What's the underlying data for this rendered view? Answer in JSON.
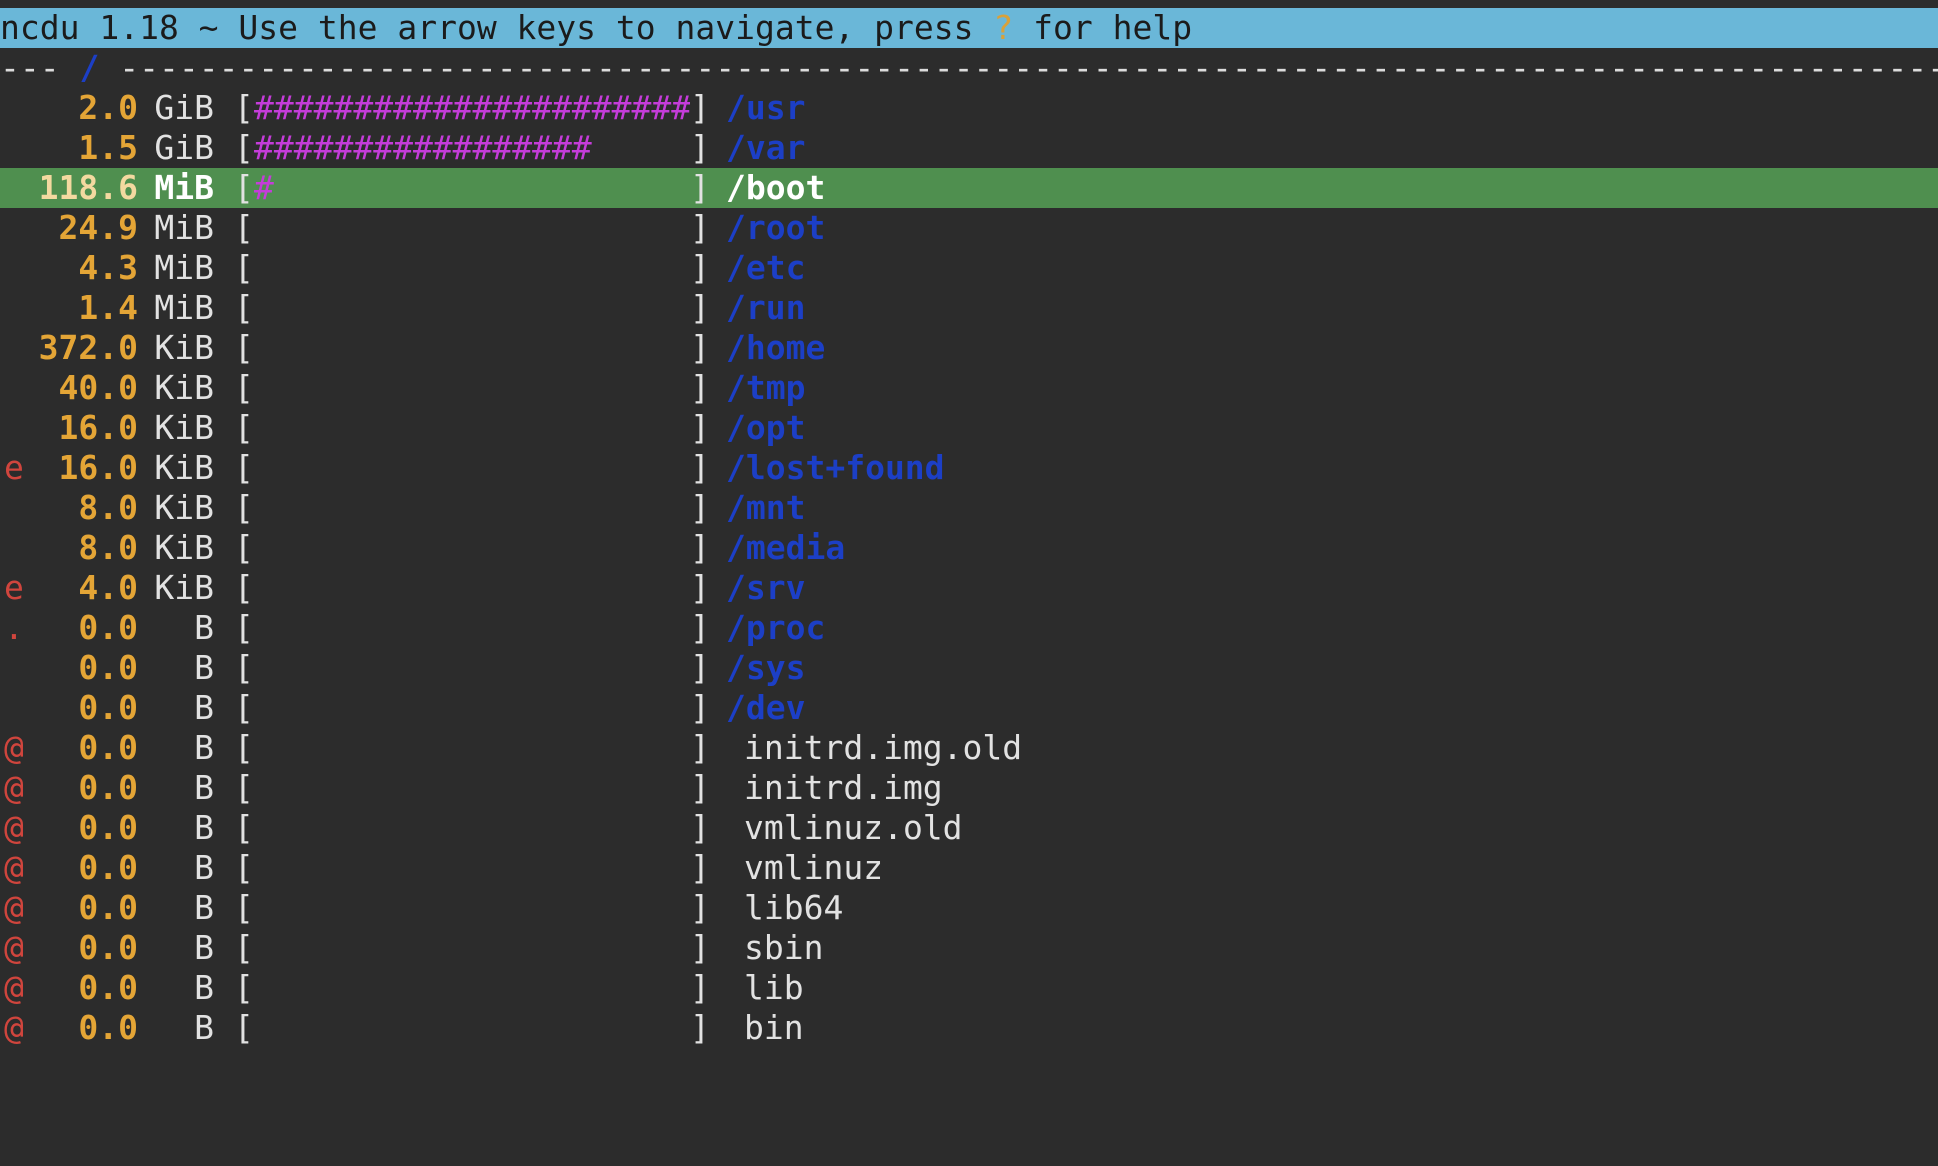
{
  "app": {
    "title_text": "ncdu 1.18 ~ Use the arrow keys to navigate, press ",
    "help_key": "?",
    "title_tail": " for help"
  },
  "path_bar": {
    "left_dashes": "--- ",
    "path": "/",
    "right_dashes": " ----------------------------------------------------------------------------------------------------------------------------------------"
  },
  "colors": {
    "header_bg": "#6ab7d8",
    "selected_bg": "#4f8f4f",
    "size_color": "#e4a536",
    "bar_color": "#c43cd9",
    "dir_color": "#1c3fc6",
    "flag_color": "#d0453d"
  },
  "selected_index": 2,
  "entries": [
    {
      "flag": "",
      "size": "2.0",
      "unit": "GiB",
      "bar": "#######################",
      "name": "/usr",
      "dir": true
    },
    {
      "flag": "",
      "size": "1.5",
      "unit": "GiB",
      "bar": "#################",
      "name": "/var",
      "dir": true
    },
    {
      "flag": "",
      "size": "118.6",
      "unit": "MiB",
      "bar": "#",
      "name": "/boot",
      "dir": true
    },
    {
      "flag": "",
      "size": "24.9",
      "unit": "MiB",
      "bar": "",
      "name": "/root",
      "dir": true
    },
    {
      "flag": "",
      "size": "4.3",
      "unit": "MiB",
      "bar": "",
      "name": "/etc",
      "dir": true
    },
    {
      "flag": "",
      "size": "1.4",
      "unit": "MiB",
      "bar": "",
      "name": "/run",
      "dir": true
    },
    {
      "flag": "",
      "size": "372.0",
      "unit": "KiB",
      "bar": "",
      "name": "/home",
      "dir": true
    },
    {
      "flag": "",
      "size": "40.0",
      "unit": "KiB",
      "bar": "",
      "name": "/tmp",
      "dir": true
    },
    {
      "flag": "",
      "size": "16.0",
      "unit": "KiB",
      "bar": "",
      "name": "/opt",
      "dir": true
    },
    {
      "flag": "e",
      "size": "16.0",
      "unit": "KiB",
      "bar": "",
      "name": "/lost+found",
      "dir": true
    },
    {
      "flag": "",
      "size": "8.0",
      "unit": "KiB",
      "bar": "",
      "name": "/mnt",
      "dir": true
    },
    {
      "flag": "",
      "size": "8.0",
      "unit": "KiB",
      "bar": "",
      "name": "/media",
      "dir": true
    },
    {
      "flag": "e",
      "size": "4.0",
      "unit": "KiB",
      "bar": "",
      "name": "/srv",
      "dir": true
    },
    {
      "flag": ".",
      "size": "0.0",
      "unit": "B",
      "bar": "",
      "name": "/proc",
      "dir": true
    },
    {
      "flag": "",
      "size": "0.0",
      "unit": "B",
      "bar": "",
      "name": "/sys",
      "dir": true
    },
    {
      "flag": "",
      "size": "0.0",
      "unit": "B",
      "bar": "",
      "name": "/dev",
      "dir": true
    },
    {
      "flag": "@",
      "size": "0.0",
      "unit": "B",
      "bar": "",
      "name": "initrd.img.old",
      "dir": false
    },
    {
      "flag": "@",
      "size": "0.0",
      "unit": "B",
      "bar": "",
      "name": "initrd.img",
      "dir": false
    },
    {
      "flag": "@",
      "size": "0.0",
      "unit": "B",
      "bar": "",
      "name": "vmlinuz.old",
      "dir": false
    },
    {
      "flag": "@",
      "size": "0.0",
      "unit": "B",
      "bar": "",
      "name": "vmlinuz",
      "dir": false
    },
    {
      "flag": "@",
      "size": "0.0",
      "unit": "B",
      "bar": "",
      "name": "lib64",
      "dir": false
    },
    {
      "flag": "@",
      "size": "0.0",
      "unit": "B",
      "bar": "",
      "name": "sbin",
      "dir": false
    },
    {
      "flag": "@",
      "size": "0.0",
      "unit": "B",
      "bar": "",
      "name": "lib",
      "dir": false
    },
    {
      "flag": "@",
      "size": "0.0",
      "unit": "B",
      "bar": "",
      "name": "bin",
      "dir": false
    }
  ]
}
